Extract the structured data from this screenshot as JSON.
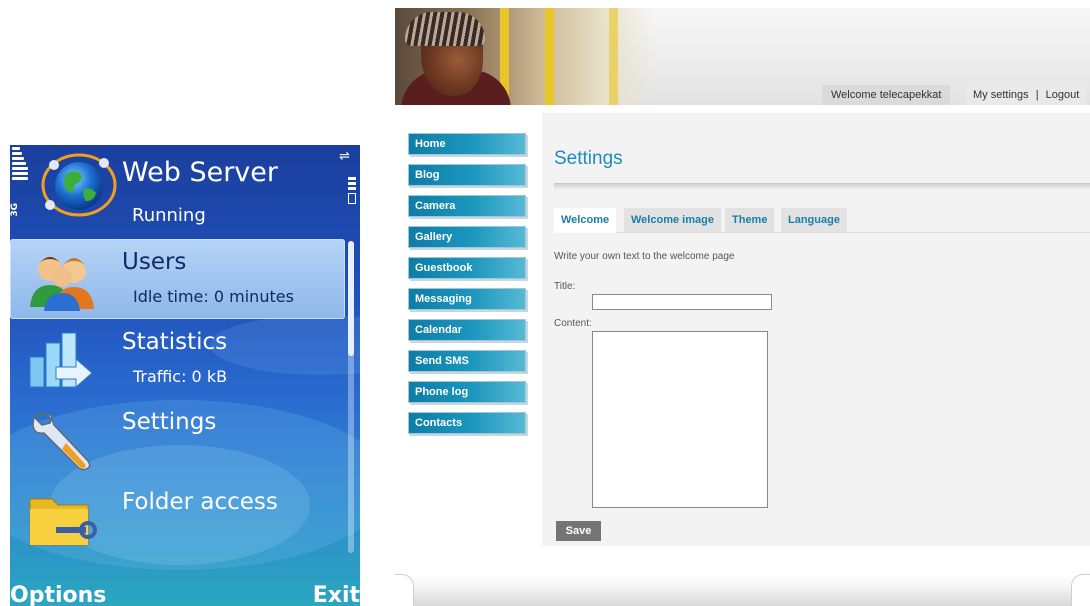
{
  "phone": {
    "app_title": "Web Server",
    "app_status": "Running",
    "network": "3G",
    "menu": [
      {
        "label": "Users",
        "sub": "Idle time: 0 minutes",
        "icon": "users-icon"
      },
      {
        "label": "Statistics",
        "sub": "Traffic: 0 kB",
        "icon": "statistics-icon"
      },
      {
        "label": "Settings",
        "sub": "",
        "icon": "wrench-icon"
      },
      {
        "label": "Folder access",
        "sub": "",
        "icon": "folder-key-icon"
      }
    ],
    "softkeys": {
      "left": "Options",
      "right": "Exit"
    }
  },
  "web": {
    "welcome": "Welcome telecapekkat",
    "my_settings": "My settings",
    "separator": "|",
    "logout": "Logout",
    "nav": [
      "Home",
      "Blog",
      "Camera",
      "Gallery",
      "Guestbook",
      "Messaging",
      "Calendar",
      "Send SMS",
      "Phone log",
      "Contacts"
    ],
    "page_title": "Settings",
    "tabs": [
      "Welcome",
      "Welcome image",
      "Theme",
      "Language"
    ],
    "intro": "Write your own text to the welcome page",
    "title_label": "Title:",
    "title_value": "",
    "content_label": "Content:",
    "content_value": "",
    "save_label": "Save"
  },
  "colors": {
    "nav_accent": "#1c97bd",
    "title_blue": "#1b8dbd",
    "phone_bg": "#1f4fb8"
  }
}
